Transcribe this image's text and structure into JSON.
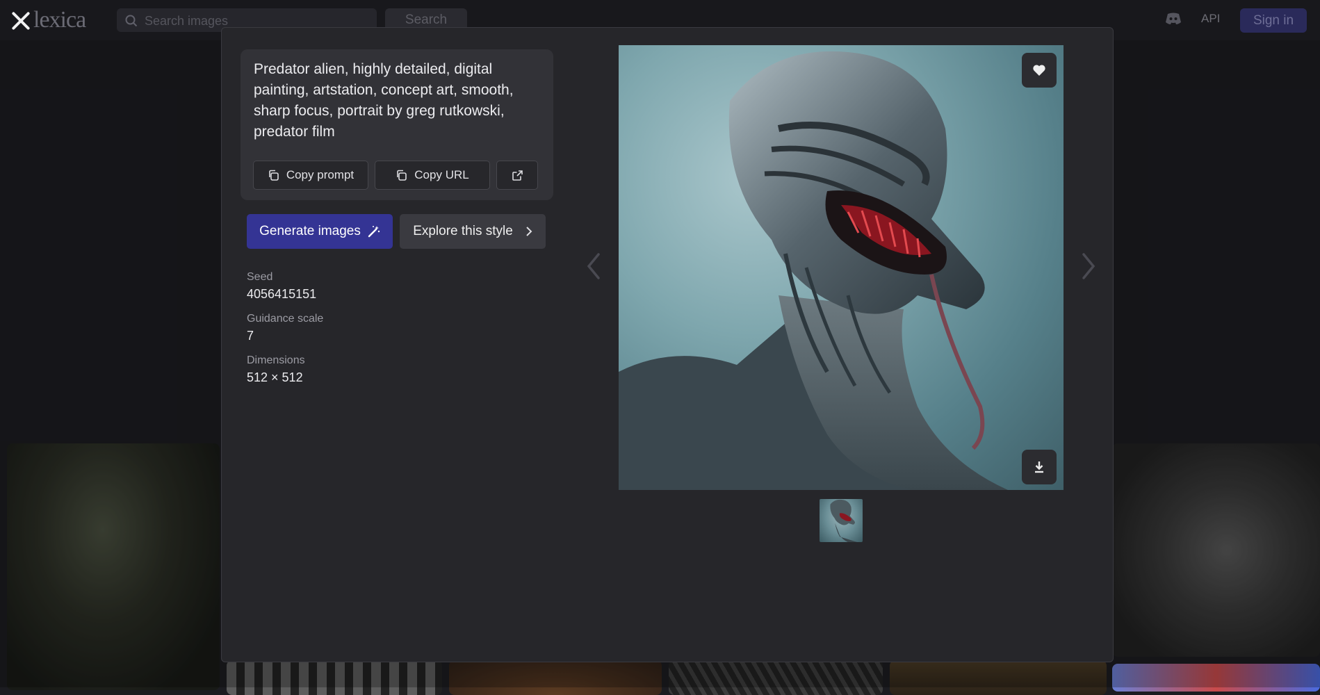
{
  "header": {
    "logo_text": "lexica",
    "search_placeholder": "Search images",
    "search_button": "Search",
    "api_label": "API",
    "signin_label": "Sign in"
  },
  "modal": {
    "prompt": "Predator alien, highly detailed, digital painting, artstation, concept art, smooth, sharp focus, portrait by greg rutkowski, predator film",
    "copy_prompt_label": "Copy prompt",
    "copy_url_label": "Copy URL",
    "generate_label": "Generate images",
    "explore_label": "Explore this style",
    "meta": [
      {
        "label": "Seed",
        "value": "4056415151"
      },
      {
        "label": "Guidance scale",
        "value": "7"
      },
      {
        "label": "Dimensions",
        "value": "512 × 512"
      }
    ]
  },
  "colors": {
    "background": "#1c1c21",
    "modal": "#26262a",
    "card": "#323237",
    "primary_button": "#343494",
    "secondary_button": "#3a3a40"
  },
  "icons": {
    "close": "close-icon",
    "search": "search-icon",
    "discord": "discord-icon",
    "copy": "copy-icon",
    "external_link": "external-link-icon",
    "magic_wand": "magic-wand-icon",
    "chevron_right": "chevron-right-icon",
    "heart": "heart-icon",
    "download": "download-icon"
  }
}
